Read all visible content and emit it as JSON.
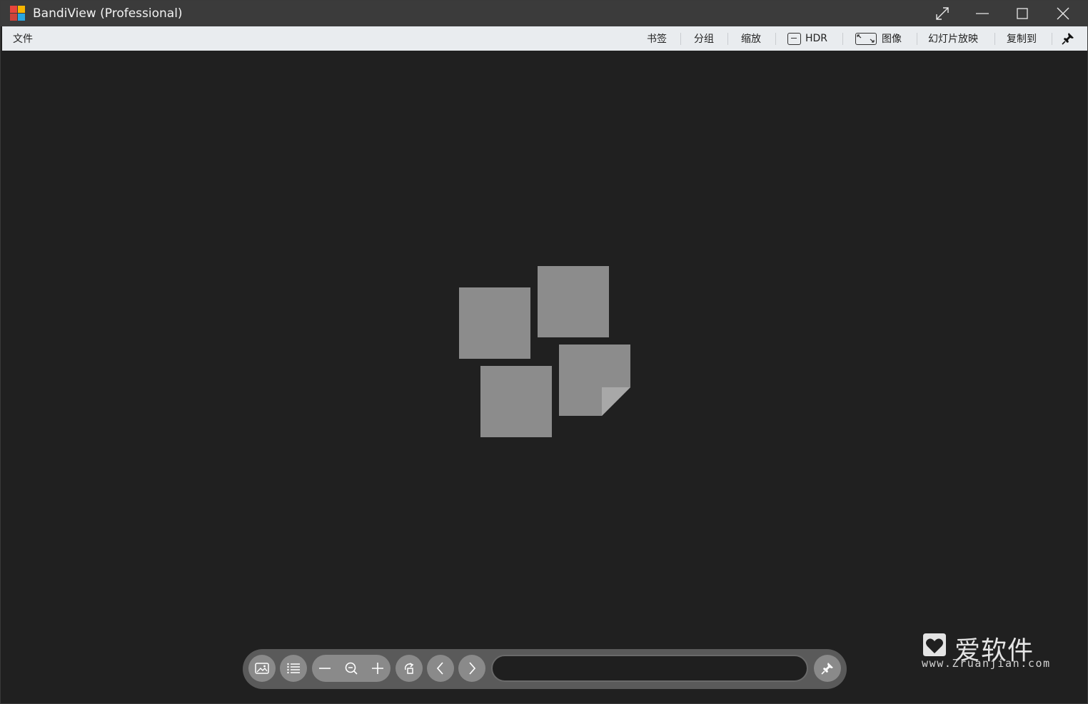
{
  "window": {
    "title": "BandiView (Professional)"
  },
  "menubar": {
    "file": "文件",
    "bookmarks": "书签",
    "group": "分组",
    "zoom": "缩放",
    "hdr": "HDR",
    "image": "图像",
    "slideshow": "幻灯片放映",
    "copy_to": "复制到"
  },
  "watermark": {
    "name": "爱软件",
    "url": "www.Zruanjian.com"
  },
  "colors": {
    "titlebar": "#3b3b3b",
    "menubar": "#e9ecef",
    "viewer_bg": "#202020",
    "placeholder": "#8c8c8c",
    "toolbar": "#5a5a5a",
    "tool_button": "#8a8a8a"
  },
  "icons": {
    "titlebar": [
      "fullscreen-icon",
      "minimize-icon",
      "maximize-icon",
      "close-icon"
    ],
    "menubar": [
      "hdr-icon",
      "image-fit-icon",
      "pin-icon"
    ],
    "toolbar": [
      "image-icon",
      "list-icon",
      "zoom-out-icon",
      "zoom-fit-icon",
      "zoom-in-icon",
      "rotate-icon",
      "previous-icon",
      "next-icon",
      "pin-icon"
    ]
  }
}
